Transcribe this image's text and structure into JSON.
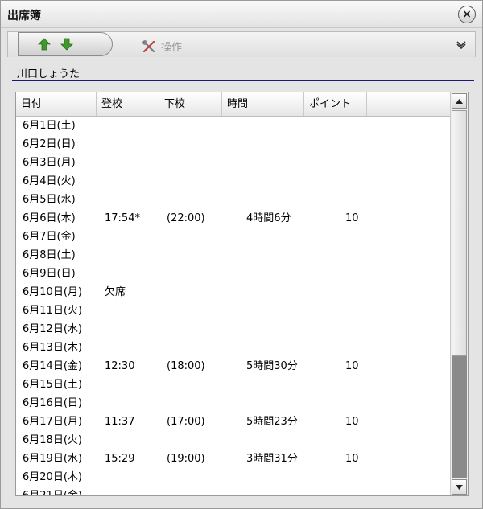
{
  "window": {
    "title": "出席簿",
    "close_glyph": "×"
  },
  "toolbar": {
    "operations_label": "操作"
  },
  "student": {
    "name": "川口しょうた"
  },
  "table": {
    "columns": [
      "日付",
      "登校",
      "下校",
      "時間",
      "ポイント"
    ],
    "rows": [
      {
        "date": "6月1日(土)",
        "in": "",
        "out": "",
        "time": "",
        "points": ""
      },
      {
        "date": "6月2日(日)",
        "in": "",
        "out": "",
        "time": "",
        "points": ""
      },
      {
        "date": "6月3日(月)",
        "in": "",
        "out": "",
        "time": "",
        "points": ""
      },
      {
        "date": "6月4日(火)",
        "in": "",
        "out": "",
        "time": "",
        "points": ""
      },
      {
        "date": "6月5日(水)",
        "in": "",
        "out": "",
        "time": "",
        "points": ""
      },
      {
        "date": "6月6日(木)",
        "in": "17:54*",
        "out": "(22:00)",
        "time": "4時間6分",
        "points": "10"
      },
      {
        "date": "6月7日(金)",
        "in": "",
        "out": "",
        "time": "",
        "points": ""
      },
      {
        "date": "6月8日(土)",
        "in": "",
        "out": "",
        "time": "",
        "points": ""
      },
      {
        "date": "6月9日(日)",
        "in": "",
        "out": "",
        "time": "",
        "points": ""
      },
      {
        "date": "6月10日(月)",
        "in": "欠席",
        "out": "",
        "time": "",
        "points": ""
      },
      {
        "date": "6月11日(火)",
        "in": "",
        "out": "",
        "time": "",
        "points": ""
      },
      {
        "date": "6月12日(水)",
        "in": "",
        "out": "",
        "time": "",
        "points": ""
      },
      {
        "date": "6月13日(木)",
        "in": "",
        "out": "",
        "time": "",
        "points": ""
      },
      {
        "date": "6月14日(金)",
        "in": "12:30",
        "out": "(18:00)",
        "time": "5時間30分",
        "points": "10"
      },
      {
        "date": "6月15日(土)",
        "in": "",
        "out": "",
        "time": "",
        "points": ""
      },
      {
        "date": "6月16日(日)",
        "in": "",
        "out": "",
        "time": "",
        "points": ""
      },
      {
        "date": "6月17日(月)",
        "in": "11:37",
        "out": "(17:00)",
        "time": "5時間23分",
        "points": "10"
      },
      {
        "date": "6月18日(火)",
        "in": "",
        "out": "",
        "time": "",
        "points": ""
      },
      {
        "date": "6月19日(水)",
        "in": "15:29",
        "out": "(19:00)",
        "time": "3時間31分",
        "points": "10"
      },
      {
        "date": "6月20日(木)",
        "in": "",
        "out": "",
        "time": "",
        "points": ""
      },
      {
        "date": "6月21日(金)",
        "in": "",
        "out": "",
        "time": "",
        "points": ""
      }
    ]
  },
  "icons": {
    "up": "up-arrow-icon",
    "down": "down-arrow-icon",
    "operations": "tools-icon",
    "collapse": "chevron-down-icon"
  },
  "colors": {
    "arrow_green": "#3f9a2b",
    "underline_navy": "#1a1a7a",
    "disabled_text": "#9a9a9a"
  }
}
